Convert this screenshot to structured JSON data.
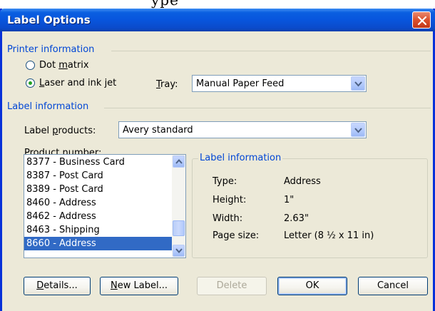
{
  "window": {
    "title": "Label Options"
  },
  "printer_info": {
    "group_label": "Printer information",
    "dot_matrix": {
      "label_pre": "Dot ",
      "label_u": "m",
      "label_post": "atrix",
      "checked": false
    },
    "laser": {
      "label_u": "L",
      "label_post": "aser and ink jet",
      "checked": true
    },
    "tray": {
      "label_u": "T",
      "label_post": "ray:",
      "value": "Manual Paper Feed"
    }
  },
  "label_info": {
    "group_label": "Label information",
    "label_products": {
      "label_pre": "Label ",
      "label_u": "p",
      "label_post": "roducts:",
      "value": "Avery standard"
    },
    "product_number": {
      "label_pre": "Product n",
      "label_u": "u",
      "label_post": "mber:",
      "items": [
        "8377 - Business Card",
        "8387 - Post Card",
        "8389 - Post Card",
        "8460 - Address",
        "8462 - Address",
        "8463 - Shipping",
        "8660 - Address"
      ],
      "selected": "8660 - Address"
    },
    "details": {
      "title": "Label information",
      "type_key": "Type:",
      "type_val": "Address",
      "height_key": "Height:",
      "height_val": "1\"",
      "width_key": "Width:",
      "width_val": "2.63\"",
      "page_key": "Page size:",
      "page_val": "Letter (8 ½ x 11 in)"
    }
  },
  "buttons": {
    "details": {
      "label_u": "D",
      "label_post": "etails..."
    },
    "new_label": {
      "label_u": "N",
      "label_post": "ew Label..."
    },
    "delete": "Delete",
    "ok": "OK",
    "cancel": "Cancel"
  },
  "colors": {
    "titlebar": "#0855dd",
    "group_label": "#0046d5",
    "selection": "#316ac5",
    "close": "#d9502d"
  }
}
